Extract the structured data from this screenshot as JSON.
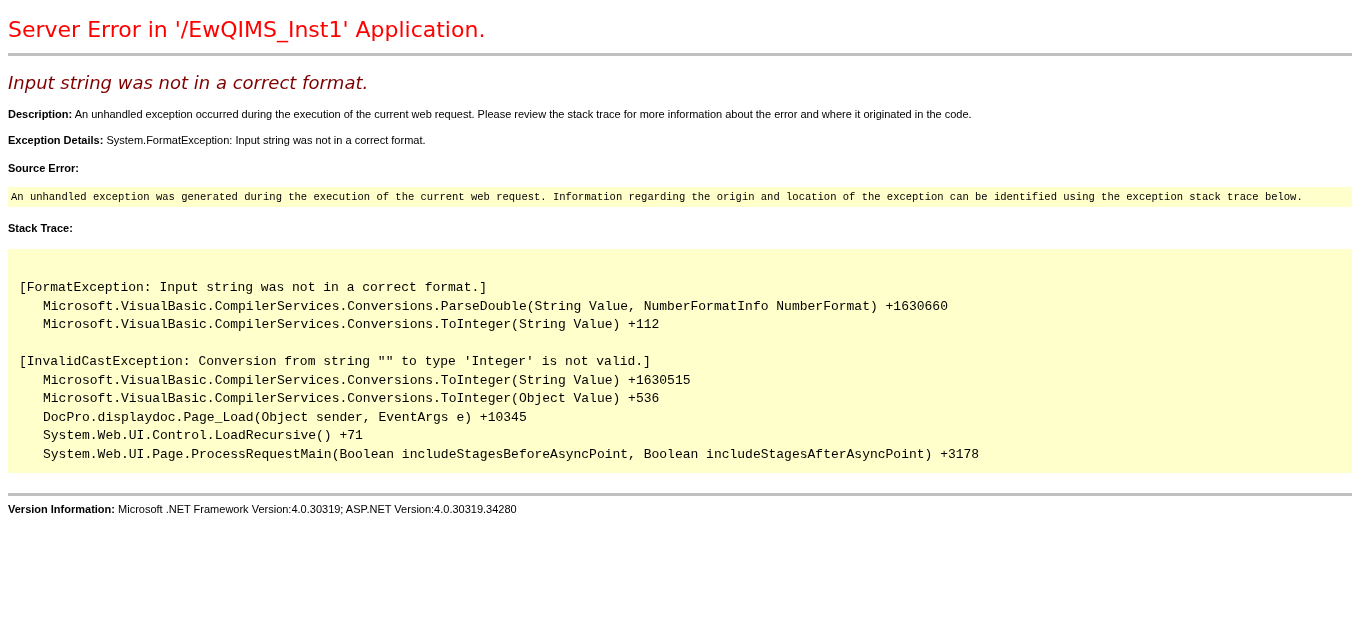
{
  "title": "Server Error in '/EwQIMS_Inst1' Application.",
  "subtitle": "Input string was not in a correct format.",
  "description": {
    "label": "Description:",
    "text": "An unhandled exception occurred during the execution of the current web request. Please review the stack trace for more information about the error and where it originated in the code."
  },
  "exception_details": {
    "label": "Exception Details:",
    "text": "System.FormatException: Input string was not in a correct format."
  },
  "source_error": {
    "label": "Source Error:",
    "text": "An unhandled exception was generated during the execution of the current web request. Information regarding the origin and location of the exception can be identified using the exception stack trace below."
  },
  "stack_trace": {
    "label": "Stack Trace:",
    "blocks": [
      {
        "header": "[FormatException: Input string was not in a correct format.]",
        "frames": [
          "Microsoft.VisualBasic.CompilerServices.Conversions.ParseDouble(String Value, NumberFormatInfo NumberFormat) +1630660",
          "Microsoft.VisualBasic.CompilerServices.Conversions.ToInteger(String Value) +112"
        ]
      },
      {
        "header": "[InvalidCastException: Conversion from string \"\" to type 'Integer' is not valid.]",
        "frames": [
          "Microsoft.VisualBasic.CompilerServices.Conversions.ToInteger(String Value) +1630515",
          "Microsoft.VisualBasic.CompilerServices.Conversions.ToInteger(Object Value) +536",
          "DocPro.displaydoc.Page_Load(Object sender, EventArgs e) +10345",
          "System.Web.UI.Control.LoadRecursive() +71",
          "System.Web.UI.Page.ProcessRequestMain(Boolean includeStagesBeforeAsyncPoint, Boolean includeStagesAfterAsyncPoint) +3178"
        ]
      }
    ]
  },
  "version": {
    "label": "Version Information:",
    "text": "Microsoft .NET Framework Version:4.0.30319; ASP.NET Version:4.0.30319.34280"
  }
}
